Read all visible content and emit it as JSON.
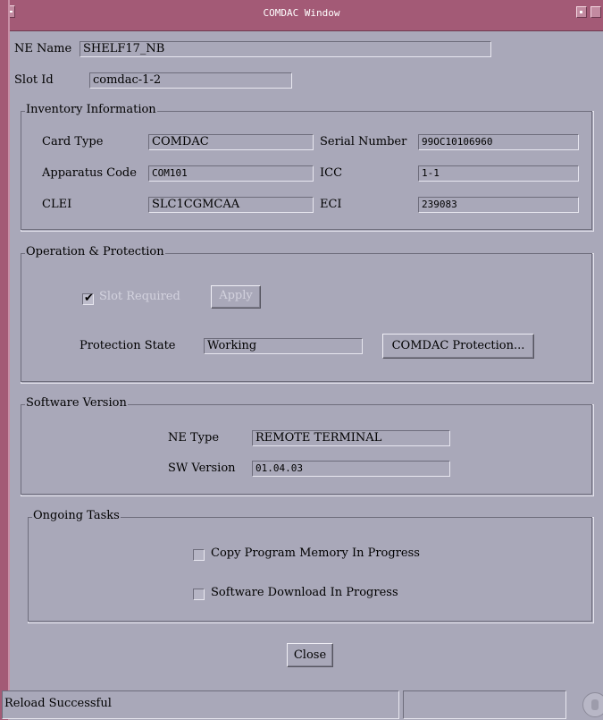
{
  "window": {
    "title": "COMDAC Window"
  },
  "ne": {
    "name_label": "NE Name",
    "name_value": "SHELF17_NB",
    "slot_label": "Slot Id",
    "slot_value": "comdac-1-2"
  },
  "inventory": {
    "title": "Inventory Information",
    "card_type_label": "Card Type",
    "card_type_value": "COMDAC",
    "serial_label": "Serial Number",
    "serial_value": "99OC10106960",
    "apparatus_label": "Apparatus Code",
    "apparatus_value": "COM101",
    "icc_label": "ICC",
    "icc_value": "1-1",
    "clei_label": "CLEI",
    "clei_value": "SLC1CGMCAA",
    "eci_label": "ECI",
    "eci_value": "239083"
  },
  "operation": {
    "title": "Operation & Protection",
    "slot_required_label": "Slot Required",
    "slot_required_checked": true,
    "apply_label": "Apply",
    "protection_state_label": "Protection State",
    "protection_state_value": "Working",
    "comdac_protection_label": "COMDAC Protection..."
  },
  "software": {
    "title": "Software Version",
    "ne_type_label": "NE Type",
    "ne_type_value": "REMOTE TERMINAL",
    "sw_version_label": "SW Version",
    "sw_version_value": "01.04.03"
  },
  "tasks": {
    "title": "Ongoing Tasks",
    "copy_label": "Copy Program Memory In Progress",
    "download_label": "Software Download In Progress"
  },
  "close_label": "Close",
  "status": {
    "message": "Reload Successful"
  },
  "colors": {
    "background": "#a9a8b9",
    "titlebar": "#a35a76"
  }
}
